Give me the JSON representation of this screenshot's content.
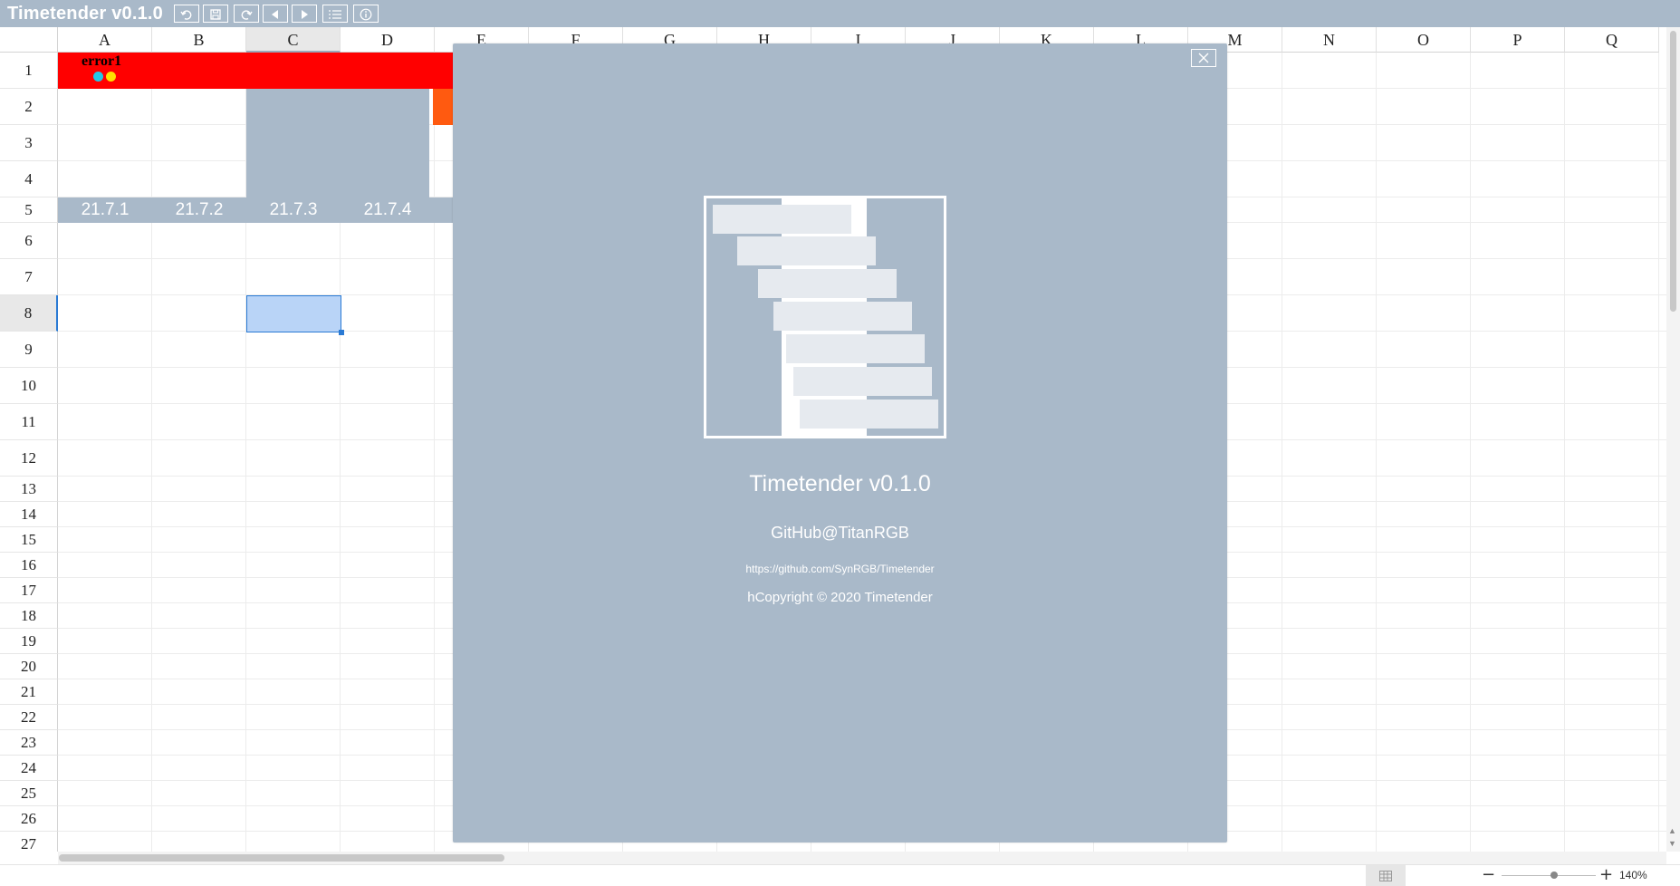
{
  "app": {
    "title": "Timetender v0.1.0"
  },
  "toolbar": {
    "buttons": [
      {
        "name": "undo-icon"
      },
      {
        "name": "save-icon"
      },
      {
        "name": "redo-icon"
      },
      {
        "name": "prev-icon"
      },
      {
        "name": "next-icon"
      },
      {
        "name": "list-icon"
      },
      {
        "name": "info-icon"
      }
    ]
  },
  "sheet": {
    "columns": [
      "A",
      "B",
      "C",
      "D",
      "E",
      "F",
      "G",
      "H",
      "I",
      "J",
      "K",
      "L",
      "M",
      "N",
      "O",
      "P",
      "Q"
    ],
    "rows": [
      "1",
      "2",
      "3",
      "4",
      "5",
      "6",
      "7",
      "8",
      "9",
      "10",
      "11",
      "12",
      "13",
      "14",
      "15",
      "16",
      "17",
      "18",
      "19",
      "20",
      "21",
      "22",
      "23",
      "24",
      "25",
      "26",
      "27"
    ],
    "selected_column": "C",
    "selected_row": "8",
    "event": {
      "label": "error1",
      "color": "#ff0000",
      "dot_colors": [
        "#22c8e8",
        "#ffe000"
      ]
    },
    "dates": [
      "21.7.1",
      "21.7.2",
      "21.7.3",
      "21.7.4"
    ],
    "accent_color": "#a9b9c9",
    "orange_color": "#ff5a10"
  },
  "status": {
    "zoom": "140%",
    "minus_label": "−",
    "plus_label": "+"
  },
  "about": {
    "title": "Timetender v0.1.0",
    "author": "GitHub@TitanRGB",
    "url": "https://github.com/SynRGB/Timetender",
    "copyright": "hCopyright © 2020 Timetender",
    "close_label": "✕"
  }
}
